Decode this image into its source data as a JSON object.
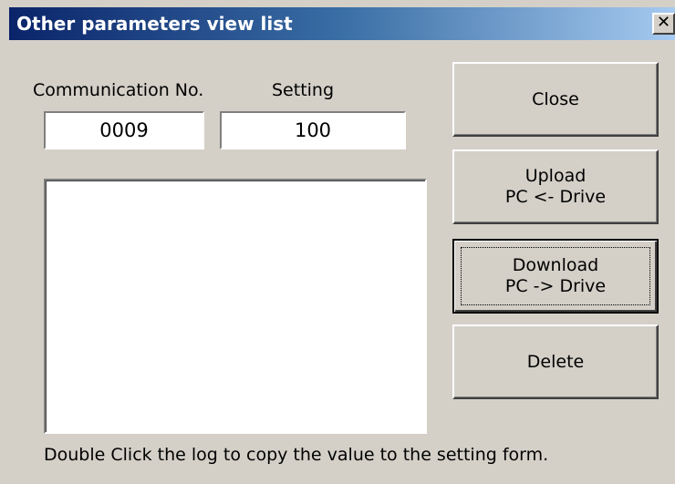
{
  "window": {
    "title": "Other parameters view list",
    "close_glyph": "✕"
  },
  "labels": {
    "communication_no": "Communication No.",
    "setting": "Setting"
  },
  "fields": {
    "communication_no_value": "0009",
    "setting_value": "100"
  },
  "buttons": {
    "close": "Close",
    "upload_line1": "Upload",
    "upload_line2": "PC <- Drive",
    "download_line1": "Download",
    "download_line2": "PC -> Drive",
    "delete": "Delete"
  },
  "hint": "Double Click the log to copy the value to the setting form.",
  "colors": {
    "titlebar_start": "#0a246a",
    "titlebar_end": "#a6caf0",
    "face": "#d4d0c8"
  }
}
